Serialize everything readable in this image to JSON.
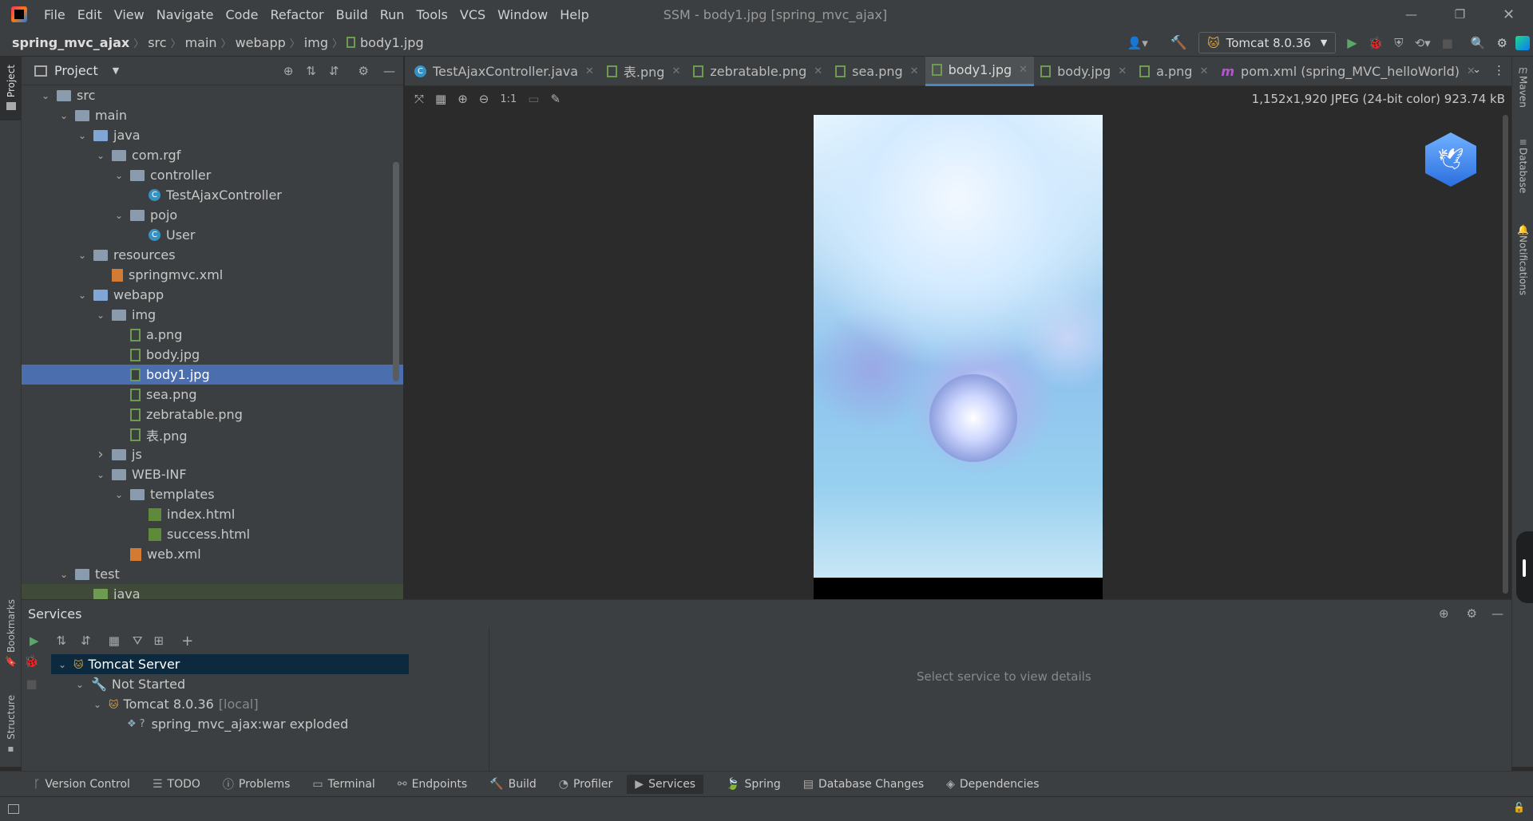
{
  "menu": [
    "File",
    "Edit",
    "View",
    "Navigate",
    "Code",
    "Refactor",
    "Build",
    "Run",
    "Tools",
    "VCS",
    "Window",
    "Help"
  ],
  "window_title": "SSM - body1.jpg [spring_mvc_ajax]",
  "breadcrumb": [
    "spring_mvc_ajax",
    "src",
    "main",
    "webapp",
    "img",
    "body1.jpg"
  ],
  "run_config": "Tomcat 8.0.36",
  "left_strip": {
    "project": "Project",
    "bookmarks": "Bookmarks",
    "structure": "Structure"
  },
  "right_strip": {
    "maven": "Maven",
    "database": "Database",
    "notifications": "Notifications"
  },
  "project_panel": {
    "title": "Project"
  },
  "tree": [
    {
      "label": "src",
      "indent": 0,
      "chev": "v",
      "icon": "folder"
    },
    {
      "label": "main",
      "indent": 1,
      "chev": "v",
      "icon": "folder"
    },
    {
      "label": "java",
      "indent": 2,
      "chev": "v",
      "icon": "folder-blue"
    },
    {
      "label": "com.rgf",
      "indent": 3,
      "chev": "v",
      "icon": "folder"
    },
    {
      "label": "controller",
      "indent": 4,
      "chev": "v",
      "icon": "folder"
    },
    {
      "label": "TestAjaxController",
      "indent": 5,
      "chev": "",
      "icon": "class"
    },
    {
      "label": "pojo",
      "indent": 4,
      "chev": "v",
      "icon": "folder"
    },
    {
      "label": "User",
      "indent": 5,
      "chev": "",
      "icon": "class"
    },
    {
      "label": "resources",
      "indent": 2,
      "chev": "v",
      "icon": "folder"
    },
    {
      "label": "springmvc.xml",
      "indent": 3,
      "chev": "",
      "icon": "xml"
    },
    {
      "label": "webapp",
      "indent": 2,
      "chev": "v",
      "icon": "folder-blue"
    },
    {
      "label": "img",
      "indent": 3,
      "chev": "v",
      "icon": "folder"
    },
    {
      "label": "a.png",
      "indent": 4,
      "chev": "",
      "icon": "image"
    },
    {
      "label": "body.jpg",
      "indent": 4,
      "chev": "",
      "icon": "image"
    },
    {
      "label": "body1.jpg",
      "indent": 4,
      "chev": "",
      "icon": "image",
      "selected": true
    },
    {
      "label": "sea.png",
      "indent": 4,
      "chev": "",
      "icon": "image"
    },
    {
      "label": "zebratable.png",
      "indent": 4,
      "chev": "",
      "icon": "image"
    },
    {
      "label": "表.png",
      "indent": 4,
      "chev": "",
      "icon": "image"
    },
    {
      "label": "js",
      "indent": 3,
      "chev": ">",
      "icon": "folder"
    },
    {
      "label": "WEB-INF",
      "indent": 3,
      "chev": "v",
      "icon": "folder"
    },
    {
      "label": "templates",
      "indent": 4,
      "chev": "v",
      "icon": "folder"
    },
    {
      "label": "index.html",
      "indent": 5,
      "chev": "",
      "icon": "html"
    },
    {
      "label": "success.html",
      "indent": 5,
      "chev": "",
      "icon": "html"
    },
    {
      "label": "web.xml",
      "indent": 4,
      "chev": "",
      "icon": "xml"
    },
    {
      "label": "test",
      "indent": 1,
      "chev": "v",
      "icon": "folder"
    },
    {
      "label": "java",
      "indent": 2,
      "chev": "",
      "icon": "folder-green"
    }
  ],
  "tabs": [
    {
      "label": "TestAjaxController.java",
      "icon": "class"
    },
    {
      "label": "表.png",
      "icon": "image"
    },
    {
      "label": "zebratable.png",
      "icon": "image"
    },
    {
      "label": "sea.png",
      "icon": "image"
    },
    {
      "label": "body1.jpg",
      "icon": "image",
      "active": true
    },
    {
      "label": "body.jpg",
      "icon": "image"
    },
    {
      "label": "a.png",
      "icon": "image"
    },
    {
      "label": "pom.xml (spring_MVC_helloWorld)",
      "icon": "maven"
    }
  ],
  "image_info": "1,152x1,920 JPEG (24-bit color) 923.74 kB",
  "services": {
    "title": "Services",
    "detail_placeholder": "Select service to view details",
    "tree": {
      "root": "Tomcat Server",
      "group": "Not Started",
      "server": "Tomcat 8.0.36",
      "server_suffix": "[local]",
      "artifact": "spring_mvc_ajax:war exploded"
    }
  },
  "bottom_tabs": [
    "Version Control",
    "TODO",
    "Problems",
    "Terminal",
    "Endpoints",
    "Build",
    "Profiler",
    "Services",
    "Spring",
    "Database Changes",
    "Dependencies"
  ],
  "active_bottom_tab": "Services",
  "colors": {
    "accent": "#4a88c7",
    "selection": "#4b6eaf",
    "run": "#59a869",
    "tomcat": "#d9a343"
  }
}
